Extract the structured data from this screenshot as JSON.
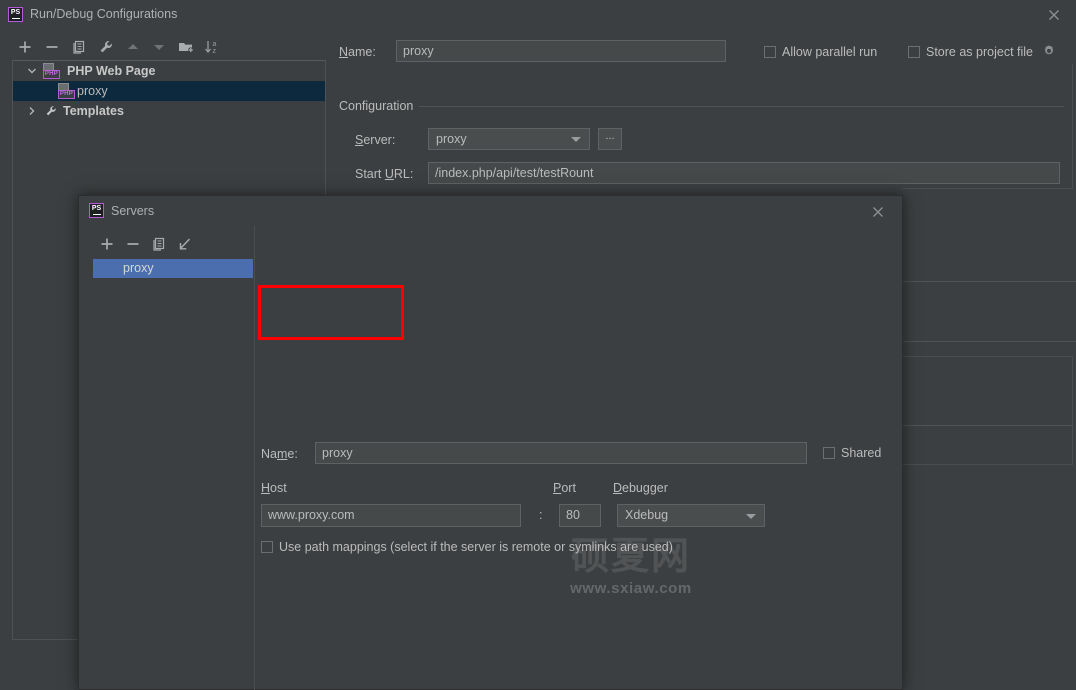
{
  "window": {
    "title": "Run/Debug Configurations",
    "app_icon": "phpstorm-logo-icon",
    "close_icon": "close-icon"
  },
  "toolbar": {
    "buttons": [
      {
        "name": "add-button",
        "icon": "plus-icon"
      },
      {
        "name": "remove-button",
        "icon": "minus-icon"
      },
      {
        "name": "copy-button",
        "icon": "copy-icon"
      },
      {
        "name": "edit-templates-button",
        "icon": "wrench-icon"
      },
      {
        "name": "move-up-button",
        "icon": "arrow-up-icon"
      },
      {
        "name": "move-down-button",
        "icon": "arrow-down-icon"
      },
      {
        "name": "move-into-folder-button",
        "icon": "folder-add-icon"
      },
      {
        "name": "sort-button",
        "icon": "sort-az-icon"
      }
    ]
  },
  "tree": {
    "nodes": [
      {
        "label": "PHP Web Page",
        "expanded": true,
        "bold": true,
        "icon": "php-web-page-icon",
        "selected": false
      },
      {
        "label": "proxy",
        "expanded": null,
        "bold": false,
        "icon": "php-web-page-icon",
        "selected": true
      },
      {
        "label": "Templates",
        "expanded": false,
        "bold": true,
        "icon": "wrench-icon",
        "selected": false
      }
    ]
  },
  "config_form": {
    "name_label": "Name:",
    "name_value": "proxy",
    "allow_parallel_run": {
      "label": "Allow parallel run",
      "checked": false
    },
    "store_as_project_file": {
      "label": "Store as project file",
      "checked": false,
      "gear_icon": "gear-icon"
    },
    "group_title": "Configuration",
    "server_label": "Server:",
    "server_value": "proxy",
    "server_browse_label": "...",
    "start_url_label": "Start URL:",
    "start_url_value": "/index.php/api/test/testRount"
  },
  "servers_dialog": {
    "title": "Servers",
    "app_icon": "phpstorm-logo-icon",
    "close_icon": "close-icon",
    "toolbar_buttons": [
      {
        "name": "add-server-button",
        "icon": "plus-icon"
      },
      {
        "name": "remove-server-button",
        "icon": "minus-icon"
      },
      {
        "name": "copy-server-button",
        "icon": "copy-icon"
      },
      {
        "name": "import-server-button",
        "icon": "import-arrow-icon"
      }
    ],
    "list": [
      {
        "label": "proxy",
        "selected": true
      }
    ],
    "name_label": "Name:",
    "name_value": "proxy",
    "shared": {
      "label": "Shared",
      "checked": false
    },
    "host_label": "Host",
    "host_value": "www.proxy.com",
    "colon": ":",
    "port_label": "Port",
    "port_value": "80",
    "debugger_label": "Debugger",
    "debugger_value": "Xdebug",
    "path_mappings": {
      "label": "Use path mappings (select if the server is remote or symlinks are used)",
      "checked": false
    }
  },
  "annotation": {
    "highlight_color": "#ff0000",
    "target": "host-field"
  },
  "watermark": {
    "cn": "硕夏网",
    "en": "www.sxiaw.com"
  },
  "colors": {
    "background": "#3c3f41",
    "field_background": "#45494a",
    "selection_tree": "#0d293e",
    "selection_list": "#4b6eaf",
    "text": "#bbbbbb",
    "border": "#5e6264",
    "accent_purple": "#b45ad6"
  }
}
